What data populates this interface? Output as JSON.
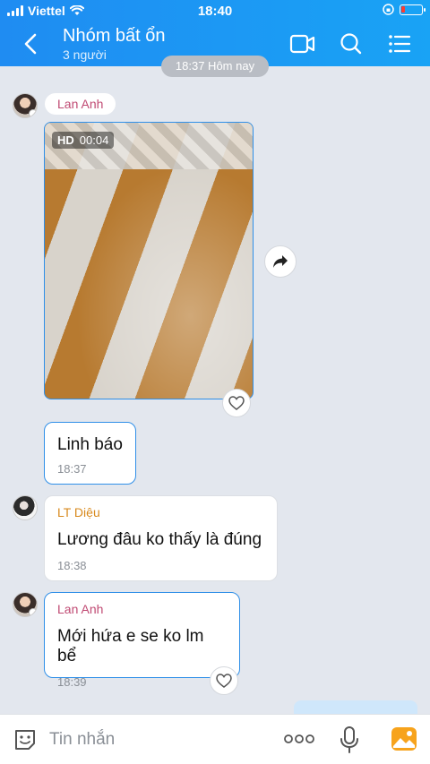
{
  "status_bar": {
    "carrier": "Viettel",
    "time": "18:40"
  },
  "header": {
    "title": "Nhóm bất ổn",
    "subtitle": "3 người"
  },
  "time_divider": "18:37 Hôm nay",
  "messages": [
    {
      "sender": "Lan Anh",
      "type": "video",
      "quality": "HD",
      "duration": "00:04"
    },
    {
      "text": "Linh báo",
      "time": "18:37"
    },
    {
      "sender": "LT Diệu",
      "text": "Lương đâu ko thấy là đúng",
      "time": "18:38"
    },
    {
      "sender": "Lan Anh",
      "text": "Mới hứa e se ko lm bể",
      "time": "18:39"
    }
  ],
  "input": {
    "placeholder": "Tin nhắn"
  },
  "colors": {
    "header": "#1f8cf2",
    "accent": "#2f8fe8",
    "sender_lan_anh": "#c04a73",
    "sender_lt_dieu": "#d88a1e"
  },
  "icons": [
    "back-icon",
    "video-call-icon",
    "search-icon",
    "menu-list-icon",
    "share-icon",
    "heart-icon",
    "sticker-icon",
    "more-icon",
    "mic-icon",
    "image-icon"
  ]
}
